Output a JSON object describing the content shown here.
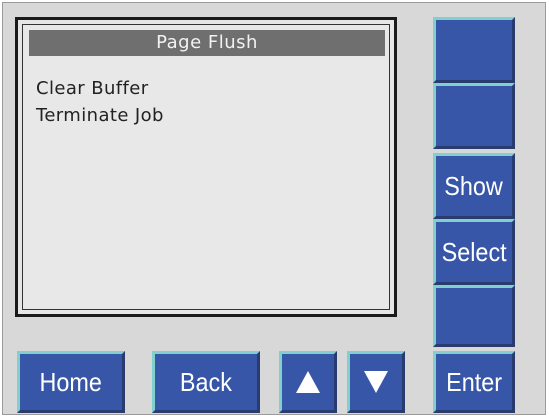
{
  "screen": {
    "title": "Page Flush",
    "lines": [
      "Clear Buffer",
      "Terminate Job"
    ]
  },
  "side_buttons": [
    {
      "label": ""
    },
    {
      "label": ""
    },
    {
      "label": "Show"
    },
    {
      "label": "Select"
    },
    {
      "label": ""
    },
    {
      "label": "Enter"
    }
  ],
  "bottom_buttons": {
    "home": "Home",
    "back": "Back",
    "up_icon": "up-arrow-icon",
    "down_icon": "down-arrow-icon"
  },
  "colors": {
    "button_blue": "#3756a8",
    "button_highlight": "#7fd0cf",
    "panel_gray": "#d8d8d8",
    "title_bar": "#6f6f6f"
  }
}
